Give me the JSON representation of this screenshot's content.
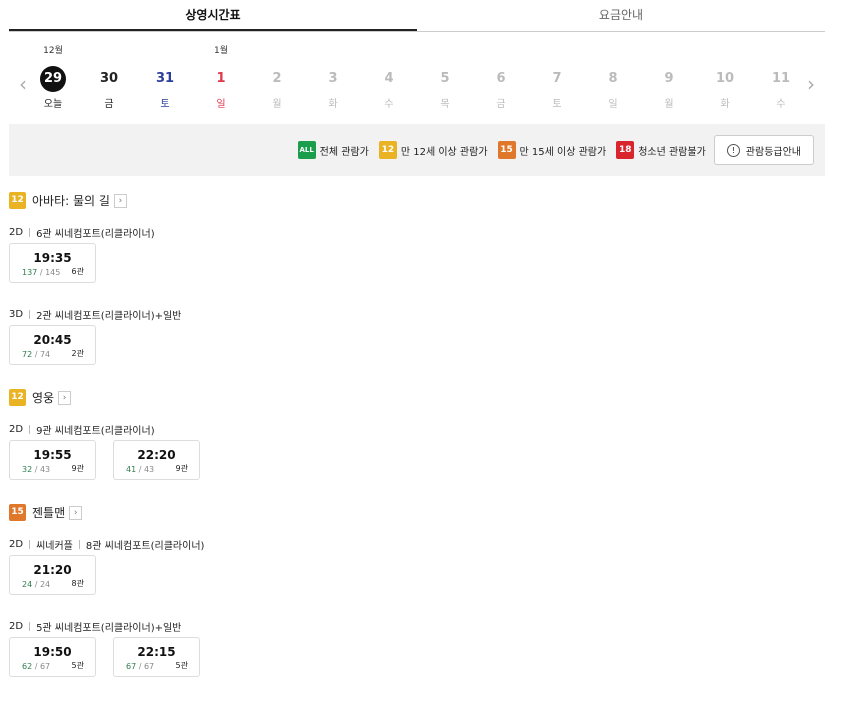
{
  "tabs": [
    {
      "label": "상영시간표",
      "active": true
    },
    {
      "label": "요금안내",
      "active": false
    }
  ],
  "dates": [
    {
      "month": "12월",
      "num": "29",
      "wd": "오늘",
      "color": "black",
      "selected": true
    },
    {
      "month": "",
      "num": "30",
      "wd": "금",
      "color": "black"
    },
    {
      "month": "",
      "num": "31",
      "wd": "토",
      "color": "blue"
    },
    {
      "month": "1월",
      "num": "1",
      "wd": "일",
      "color": "red"
    },
    {
      "month": "",
      "num": "2",
      "wd": "월",
      "color": "gray"
    },
    {
      "month": "",
      "num": "3",
      "wd": "화",
      "color": "gray"
    },
    {
      "month": "",
      "num": "4",
      "wd": "수",
      "color": "gray"
    },
    {
      "month": "",
      "num": "5",
      "wd": "목",
      "color": "gray"
    },
    {
      "month": "",
      "num": "6",
      "wd": "금",
      "color": "gray"
    },
    {
      "month": "",
      "num": "7",
      "wd": "토",
      "color": "gray"
    },
    {
      "month": "",
      "num": "8",
      "wd": "일",
      "color": "gray"
    },
    {
      "month": "",
      "num": "9",
      "wd": "월",
      "color": "gray"
    },
    {
      "month": "",
      "num": "10",
      "wd": "화",
      "color": "gray"
    },
    {
      "month": "",
      "num": "11",
      "wd": "수",
      "color": "gray"
    }
  ],
  "ratings": [
    {
      "badge": "ALL",
      "cls": "b-all",
      "label": "전체 관람가"
    },
    {
      "badge": "12",
      "cls": "b-12",
      "label": "만 12세 이상 관람가"
    },
    {
      "badge": "15",
      "cls": "b-15",
      "label": "만 15세 이상 관람가"
    },
    {
      "badge": "18",
      "cls": "b-18",
      "label": "청소년 관람불가"
    }
  ],
  "rating_info_button": "관람등급안내",
  "movies": [
    {
      "rating": "12",
      "title": "아바타: 물의 길",
      "screenings": [
        {
          "format": "2D",
          "halls": [
            "6관 씨네컴포트(리클라이너)"
          ],
          "slots": [
            {
              "time": "19:35",
              "avail": "137",
              "total": "145",
              "hall": "6관"
            }
          ]
        },
        {
          "format": "3D",
          "halls": [
            "2관 씨네컴포트(리클라이너)+일반"
          ],
          "slots": [
            {
              "time": "20:45",
              "avail": "72",
              "total": "74",
              "hall": "2관"
            }
          ]
        }
      ]
    },
    {
      "rating": "12",
      "title": "영웅",
      "screenings": [
        {
          "format": "2D",
          "halls": [
            "9관 씨네컴포트(리클라이너)"
          ],
          "slots": [
            {
              "time": "19:55",
              "avail": "32",
              "total": "43",
              "hall": "9관"
            },
            {
              "time": "22:20",
              "avail": "41",
              "total": "43",
              "hall": "9관"
            }
          ]
        }
      ]
    },
    {
      "rating": "15",
      "title": "젠틀맨",
      "screenings": [
        {
          "format": "2D",
          "halls": [
            "씨네커플",
            "8관 씨네컴포트(리클라이너)"
          ],
          "slots": [
            {
              "time": "21:20",
              "avail": "24",
              "total": "24",
              "hall": "8관"
            }
          ]
        },
        {
          "format": "2D",
          "halls": [
            "5관 씨네컴포트(리클라이너)+일반"
          ],
          "slots": [
            {
              "time": "19:50",
              "avail": "62",
              "total": "67",
              "hall": "5관"
            },
            {
              "time": "22:15",
              "avail": "67",
              "total": "67",
              "hall": "5관"
            }
          ]
        }
      ]
    }
  ]
}
